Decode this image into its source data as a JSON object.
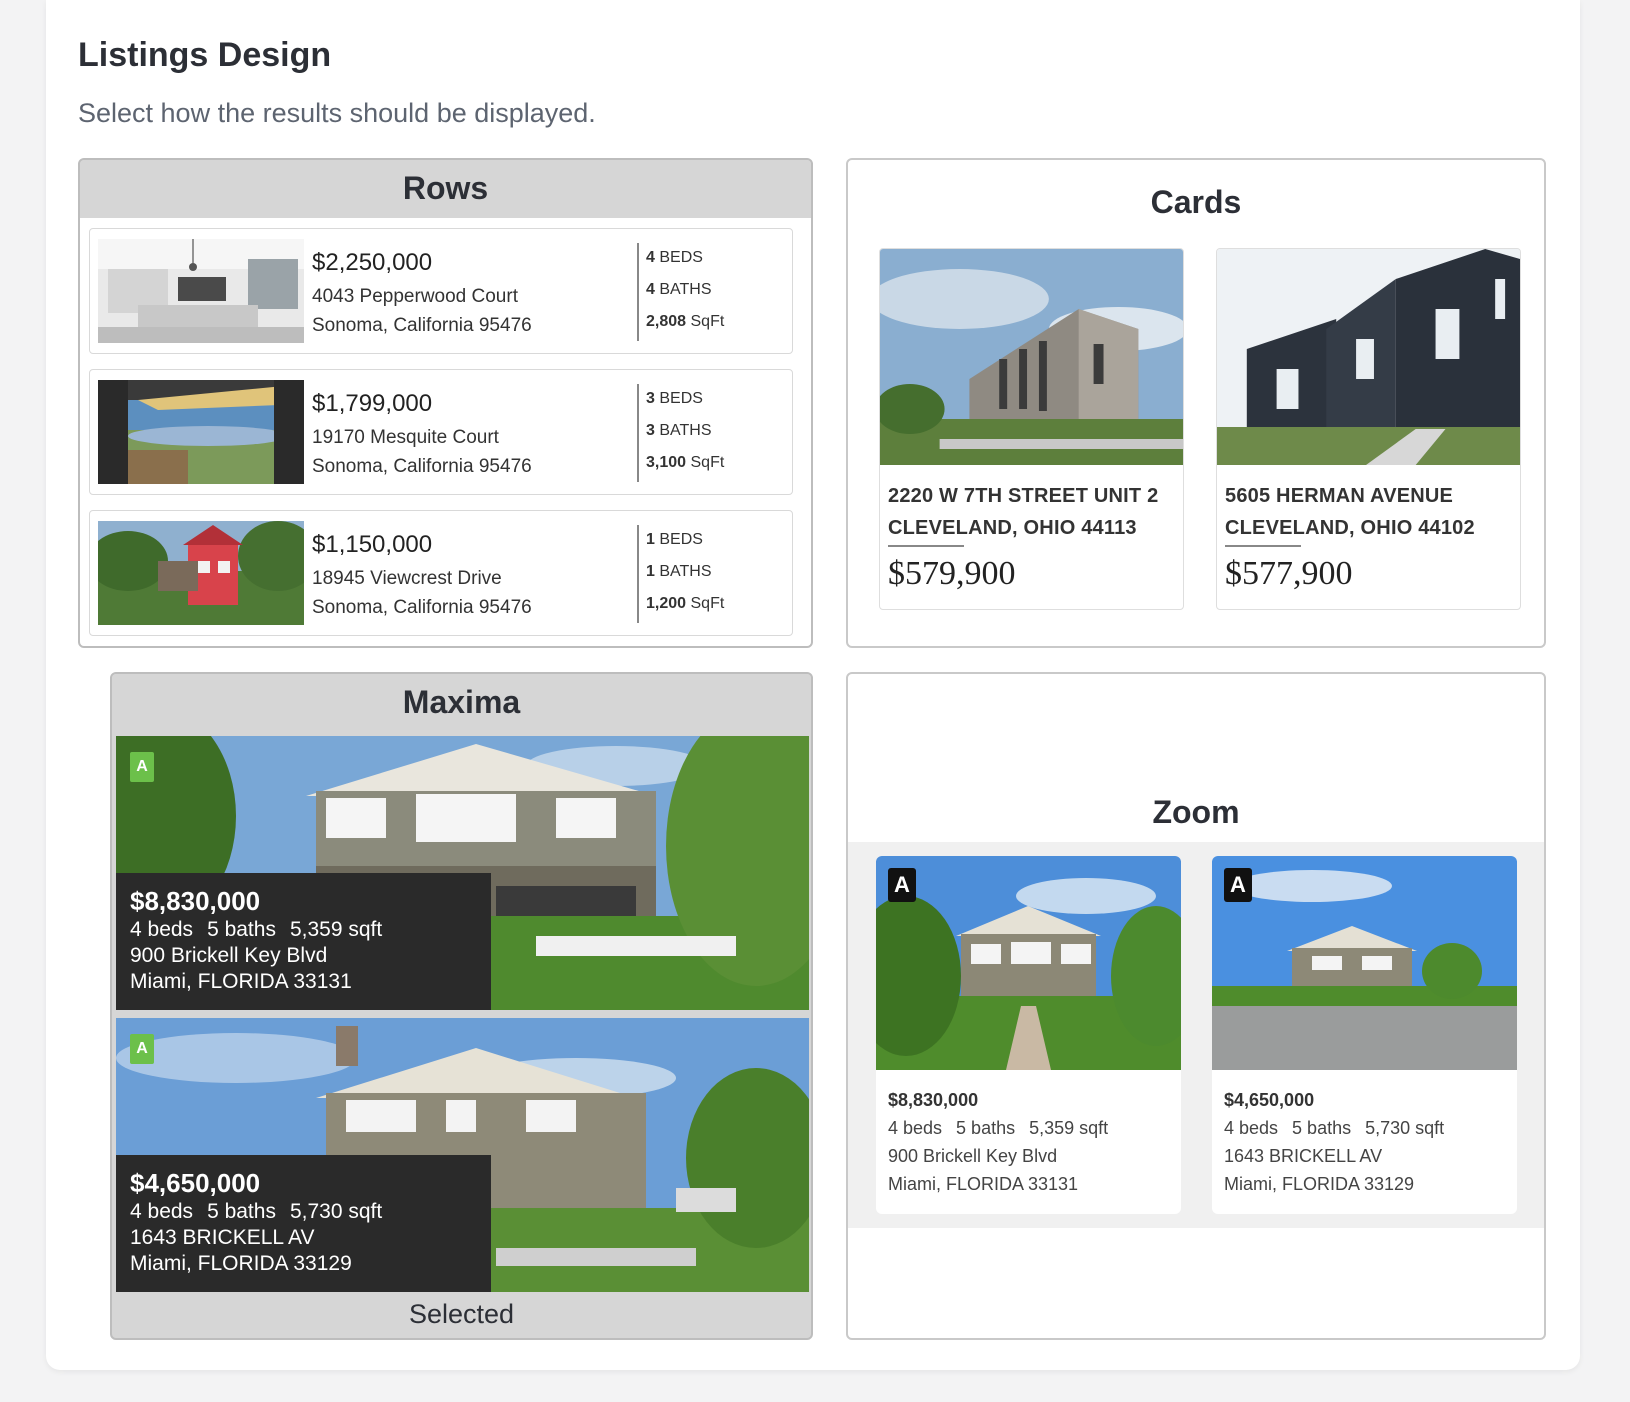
{
  "header": {
    "title": "Listings Design",
    "subtitle": "Select how the results should be displayed."
  },
  "options": {
    "rows": {
      "label": "Rows"
    },
    "cards": {
      "label": "Cards"
    },
    "maxima": {
      "label": "Maxima",
      "status": "Selected"
    },
    "zoom": {
      "label": "Zoom"
    }
  },
  "rows": [
    {
      "price": "$2,250,000",
      "address": "4043 Pepperwood Court",
      "city": "Sonoma, California 95476",
      "beds_n": "4",
      "beds_l": "BEDS",
      "baths_n": "4",
      "baths_l": "BATHS",
      "sqft_n": "2,808",
      "sqft_l": "SqFt"
    },
    {
      "price": "$1,799,000",
      "address": "19170 Mesquite Court",
      "city": "Sonoma, California 95476",
      "beds_n": "3",
      "beds_l": "BEDS",
      "baths_n": "3",
      "baths_l": "BATHS",
      "sqft_n": "3,100",
      "sqft_l": "SqFt"
    },
    {
      "price": "$1,150,000",
      "address": "18945 Viewcrest Drive",
      "city": "Sonoma, California 95476",
      "beds_n": "1",
      "beds_l": "BEDS",
      "baths_n": "1",
      "baths_l": "BATHS",
      "sqft_n": "1,200",
      "sqft_l": "SqFt"
    }
  ],
  "cards": [
    {
      "address": "2220 W 7TH STREET UNIT 2",
      "city": "CLEVELAND, OHIO 44113",
      "price": "$579,900"
    },
    {
      "address": "5605 HERMAN AVENUE",
      "city": "CLEVELAND, OHIO 44102",
      "price": "$577,900"
    }
  ],
  "maxima": [
    {
      "badge": "A",
      "price": "$8,830,000",
      "beds": "4 beds",
      "baths": "5 baths",
      "sqft": "5,359 sqft",
      "address": "900 Brickell Key Blvd",
      "city": "Miami, FLORIDA 33131"
    },
    {
      "badge": "A",
      "price": "$4,650,000",
      "beds": "4 beds",
      "baths": "5 baths",
      "sqft": "5,730 sqft",
      "address": "1643 BRICKELL AV",
      "city": "Miami, FLORIDA 33129"
    }
  ],
  "zoom": [
    {
      "badge": "A",
      "price": "$8,830,000",
      "beds": "4 beds",
      "baths": "5 baths",
      "sqft": "5,359 sqft",
      "address": "900 Brickell Key Blvd",
      "city": "Miami, FLORIDA 33131"
    },
    {
      "badge": "A",
      "price": "$4,650,000",
      "beds": "4 beds",
      "baths": "5 baths",
      "sqft": "5,730 sqft",
      "address": "1643 BRICKELL AV",
      "city": "Miami, FLORIDA 33129"
    }
  ],
  "colors": {
    "selected_bg": "#d6d6d6",
    "badge_green": "#6cc04a",
    "overlay_dark": "#2a2a2a"
  }
}
